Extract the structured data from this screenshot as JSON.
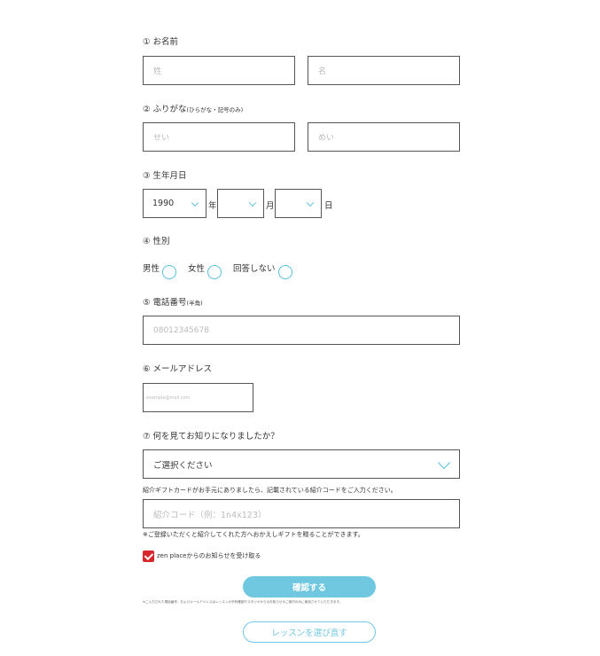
{
  "name": {
    "label": "① お名前",
    "last_placeholder": "姓",
    "first_placeholder": "名"
  },
  "furigana": {
    "label": "② ふりがな",
    "label_note": "(ひらがな・記号のみ)",
    "last_placeholder": "せい",
    "first_placeholder": "めい"
  },
  "birthday": {
    "label": "③ 生年月日",
    "year_value": "1990",
    "year_unit": "年",
    "month_value": "",
    "month_unit": "月",
    "day_value": "",
    "day_unit": "日"
  },
  "gender": {
    "label": "④ 性別",
    "options": [
      "男性",
      "女性",
      "回答しない"
    ]
  },
  "phone": {
    "label": "⑤ 電話番号",
    "label_note": "(半角)",
    "placeholder": "08012345678"
  },
  "email": {
    "label": "⑥ メールアドレス",
    "placeholder": "example@mail.com"
  },
  "referral": {
    "label": "⑦ 何を見てお知りになりましたか？",
    "select_value": "ご選択ください",
    "gift_note": "紹介ギフトカードがお手元にありましたら、記載されている紹介コードをご入力ください。",
    "code_placeholder": "紹介コード（例：1n4x123）",
    "code_note": "※ご登録いただくと紹介してくれた方へおかえしギフトを贈ることができます。"
  },
  "newsletter": {
    "label": "zen placeからのお知らせを受け取る",
    "checked": true
  },
  "actions": {
    "confirm_label": "確認する",
    "fine_print": "※ご入力された電話番号、およびメールアドレスはレッスンの予約確認やスタジオからのお知らせのご案内のみに使用させていただきます。",
    "reselect_label": "レッスンを選び直す"
  },
  "colors": {
    "accent": "#6fc8e0",
    "check": "#d7262c"
  }
}
